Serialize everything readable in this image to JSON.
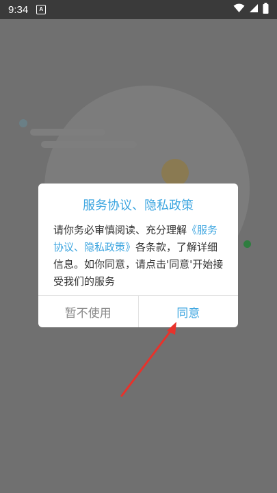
{
  "status_bar": {
    "time": "9:34",
    "notification_icon_letter": "A",
    "icons": [
      "wifi-icon",
      "signal-icon",
      "battery-icon"
    ]
  },
  "dialog": {
    "title": "服务协议、隐私政策",
    "body_prefix": "请你务必审慎阅读、充分理解",
    "body_link": "《服务协议、隐私政策》",
    "body_suffix": "各条款，了解详细信息。如你同意，请点击'同意'开始接受我们的服务",
    "decline_label": "暂不使用",
    "accept_label": "同意"
  },
  "colors": {
    "accent": "#3ea6e0",
    "overlay": "#707070",
    "annotation_arrow": "#e8322b"
  }
}
